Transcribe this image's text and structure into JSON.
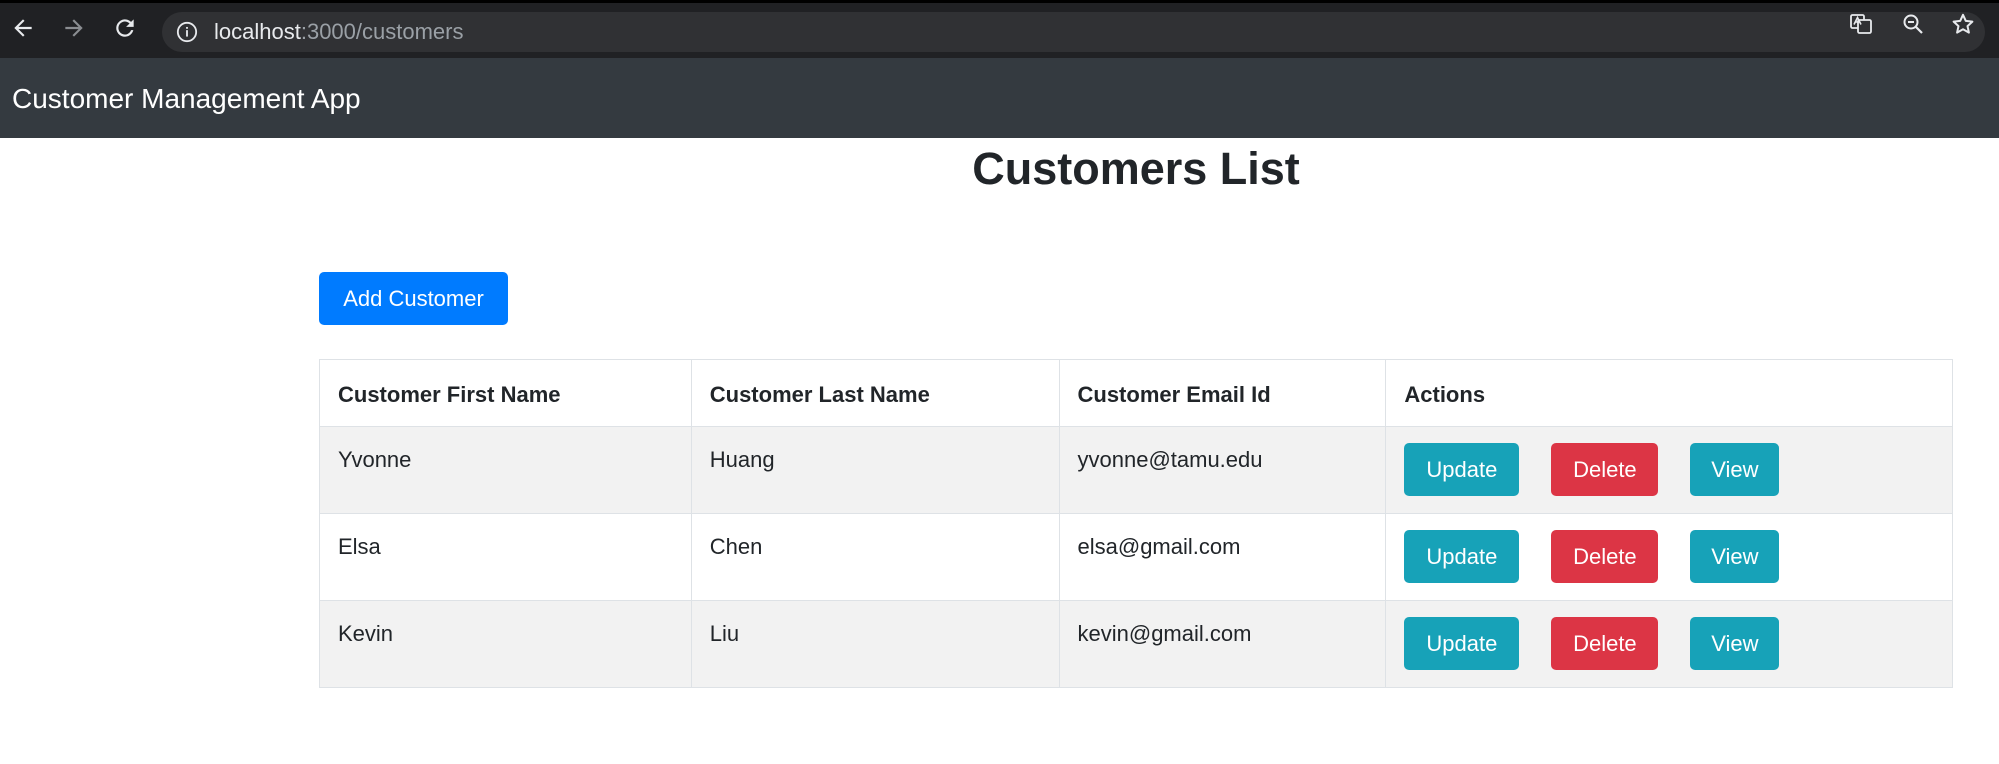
{
  "browser": {
    "url_host": "localhost",
    "url_path": ":3000/customers",
    "icons": [
      "back-icon",
      "forward-icon",
      "reload-icon",
      "info-icon",
      "translate-icon",
      "zoom-icon",
      "star-icon"
    ]
  },
  "navbar": {
    "brand": "Customer Management App"
  },
  "page": {
    "title": "Customers List",
    "add_button": "Add Customer"
  },
  "table": {
    "headers": [
      "Customer First Name",
      "Customer Last Name",
      "Customer Email Id",
      "Actions"
    ],
    "rows": [
      {
        "first": "Yvonne",
        "last": "Huang",
        "email": "yvonne@tamu.edu"
      },
      {
        "first": "Elsa",
        "last": "Chen",
        "email": "elsa@gmail.com"
      },
      {
        "first": "Kevin",
        "last": "Liu",
        "email": "kevin@gmail.com"
      }
    ],
    "actions": {
      "update": "Update",
      "delete": "Delete",
      "view": "View"
    }
  },
  "colors": {
    "primary": "#007bff",
    "info": "#17a2b8",
    "danger": "#dc3545",
    "navbar": "#343a40"
  }
}
